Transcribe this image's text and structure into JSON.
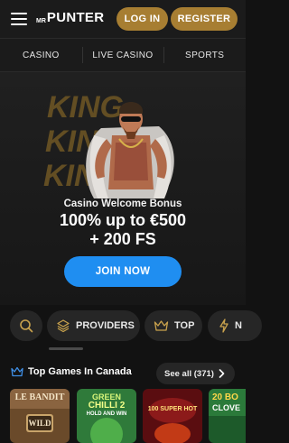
{
  "header": {
    "logo_small": "MR",
    "logo_big": "PUNTER",
    "login_label": "LOG IN",
    "register_label": "REGISTER"
  },
  "nav": {
    "items": [
      "CASINO",
      "LIVE CASINO",
      "SPORTS"
    ]
  },
  "banner": {
    "bg_text": "KING",
    "subtitle": "Casino Welcome Bonus",
    "headline_line1": "100% up to €500",
    "headline_line2": "+ 200 FS",
    "cta_label": "JOIN NOW"
  },
  "filters": {
    "providers_label": "PROVIDERS",
    "top_label": "TOP",
    "next_label": "N"
  },
  "section": {
    "title": "Top Games In Canada",
    "see_all_label": "See all (371)"
  },
  "games": [
    {
      "title_top": "LE BANDIT",
      "title_bottom": "WILD"
    },
    {
      "title_top": "GREEN",
      "title_mid": "CHILLI 2",
      "title_bottom": "HOLD AND WIN"
    },
    {
      "title_top": "100 SUPER HOT"
    },
    {
      "title_top": "20 BO",
      "title_bottom": "CLOVE"
    }
  ],
  "colors": {
    "gold": "#a77e32",
    "primary_blue": "#1f8ef1",
    "background": "#121212",
    "chip_bg": "#262626"
  },
  "icons": [
    "menu-icon",
    "search-icon",
    "providers-layers-icon",
    "crown-icon",
    "lightning-icon",
    "chevron-right-icon"
  ]
}
